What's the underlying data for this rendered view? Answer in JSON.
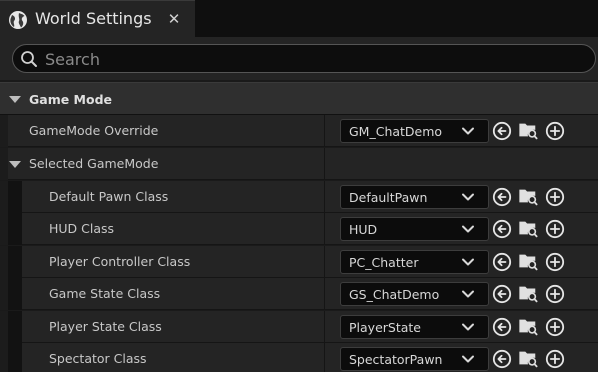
{
  "window": {
    "tab_title": "World Settings",
    "close_glyph": "✕"
  },
  "search": {
    "placeholder": "Search"
  },
  "categories": {
    "game_mode": "Game Mode"
  },
  "properties": {
    "gamemode_override": {
      "label": "GameMode Override",
      "value": "GM_ChatDemo"
    },
    "selected_gamemode": {
      "label": "Selected GameMode"
    },
    "default_pawn_class": {
      "label": "Default Pawn Class",
      "value": "DefaultPawn"
    },
    "hud_class": {
      "label": "HUD Class",
      "value": "HUD"
    },
    "player_controller_class": {
      "label": "Player Controller Class",
      "value": "PC_Chatter"
    },
    "game_state_class": {
      "label": "Game State Class",
      "value": "GS_ChatDemo"
    },
    "player_state_class": {
      "label": "Player State Class",
      "value": "PlayerState"
    },
    "spectator_class": {
      "label": "Spectator Class",
      "value": "SpectatorPawn"
    }
  },
  "icons": {
    "tab": "globe-icon",
    "search": "search-icon",
    "browse": "arrow-left-circle-icon",
    "find": "folder-search-icon",
    "add": "plus-circle-icon",
    "dropdown": "chevron-down-icon"
  },
  "colors": {
    "panel_bg": "#242424",
    "header_bg": "#2f2f2f",
    "combo_bg": "#0c0c0c",
    "text": "#c8c8c8"
  }
}
